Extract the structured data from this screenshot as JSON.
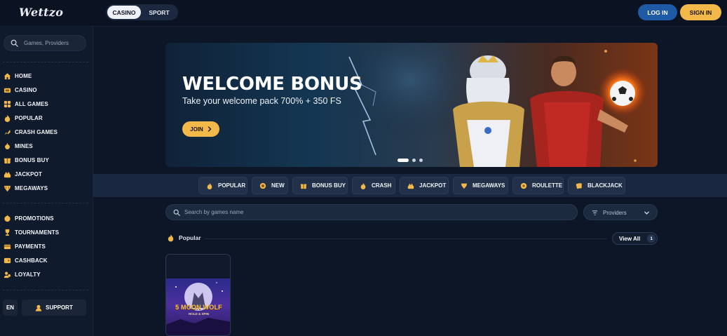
{
  "header": {
    "logo_text": "Wettzo",
    "mode_tabs": [
      "CASINO",
      "SPORT"
    ],
    "login_label": "LOG IN",
    "signin_label": "SIGN IN"
  },
  "sidebar": {
    "search_placeholder": "Games, Providers",
    "items": [
      {
        "label": "HOME",
        "icon": "home-icon"
      },
      {
        "label": "CASINO",
        "icon": "casino-icon"
      },
      {
        "label": "ALL GAMES",
        "icon": "all-games-icon"
      },
      {
        "label": "POPULAR",
        "icon": "flame-icon"
      },
      {
        "label": "CRASH GAMES",
        "icon": "crash-icon"
      },
      {
        "label": "MINES",
        "icon": "mines-icon"
      },
      {
        "label": "BONUS BUY",
        "icon": "gift-icon"
      },
      {
        "label": "JACKPOT",
        "icon": "jackpot-icon"
      },
      {
        "label": "MEGAWAYS",
        "icon": "megaways-icon"
      }
    ],
    "secondary_items": [
      {
        "label": "PROMOTIONS",
        "icon": "promotions-icon"
      },
      {
        "label": "TOURNAMENTS",
        "icon": "trophy-icon"
      },
      {
        "label": "PAYMENTS",
        "icon": "payments-icon"
      },
      {
        "label": "CASHBACK",
        "icon": "cashback-icon"
      },
      {
        "label": "LOYALTY",
        "icon": "loyalty-icon"
      }
    ],
    "language": "EN",
    "support_label": "SUPPORT"
  },
  "hero": {
    "title": "WELCOME BONUS",
    "subtitle": "Take your welcome pack 700% + 350 FS",
    "cta_label": "JOIN",
    "slides": 3,
    "active_slide": 1
  },
  "categories": [
    {
      "label": "POPULAR",
      "icon": "flame-icon"
    },
    {
      "label": "NEW",
      "icon": "new-icon"
    },
    {
      "label": "BONUS BUY",
      "icon": "gift-icon"
    },
    {
      "label": "CRASH",
      "icon": "crash-icon"
    },
    {
      "label": "JACKPOT",
      "icon": "jackpot-icon"
    },
    {
      "label": "MEGAWAYS",
      "icon": "megaways-icon"
    },
    {
      "label": "ROULETTE",
      "icon": "roulette-icon"
    },
    {
      "label": "BLACKJACK",
      "icon": "blackjack-icon"
    }
  ],
  "game_search": {
    "placeholder": "Search by games name",
    "providers_label": "Providers"
  },
  "popular_section": {
    "title": "Popular",
    "view_all_label": "View All",
    "count": "1",
    "games": [
      {
        "title": "5 MOON WOLF",
        "subtitle": "HOLD & SPIN"
      }
    ]
  },
  "colors": {
    "background": "#0d1626",
    "accent_gold": "#f2b84a",
    "login_blue": "#1f5aa6"
  }
}
